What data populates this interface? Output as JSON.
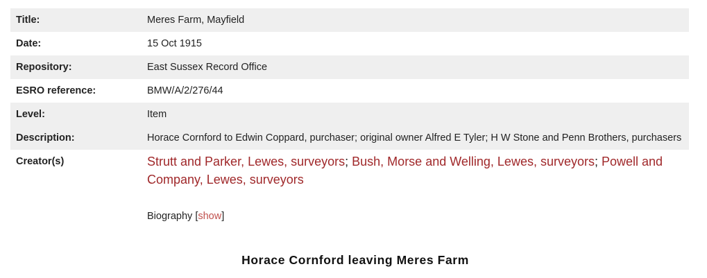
{
  "record": {
    "rows": [
      {
        "label": "Title:",
        "value": "Meres Farm, Mayfield"
      },
      {
        "label": "Date:",
        "value": "15 Oct 1915"
      },
      {
        "label": "Repository:",
        "value": "East Sussex Record Office"
      },
      {
        "label": "ESRO reference:",
        "value": "BMW/A/2/276/44"
      },
      {
        "label": "Level:",
        "value": "Item"
      },
      {
        "label": "Description:",
        "value": "Horace Cornford to Edwin Coppard, purchaser; original owner Alfred E Tyler; H W Stone and Penn Brothers, purchasers"
      }
    ],
    "creators": {
      "label": "Creator(s)",
      "links": [
        {
          "text": "Strutt and Parker, Lewes, surveyors",
          "sep": "; "
        },
        {
          "text": "Bush, Morse and Welling, Lewes, surveyors",
          "sep": "; "
        },
        {
          "text": "Powell and Company, Lewes, surveyors",
          "sep": ""
        }
      ],
      "biography_label": "Biography",
      "biography_open": "[",
      "biography_link": "show",
      "biography_close": "]"
    }
  },
  "caption": "Horace Cornford leaving Meres Farm",
  "colors": {
    "link": "#a0282a",
    "show_link": "#c0504d",
    "row_shade": "#efefef"
  }
}
